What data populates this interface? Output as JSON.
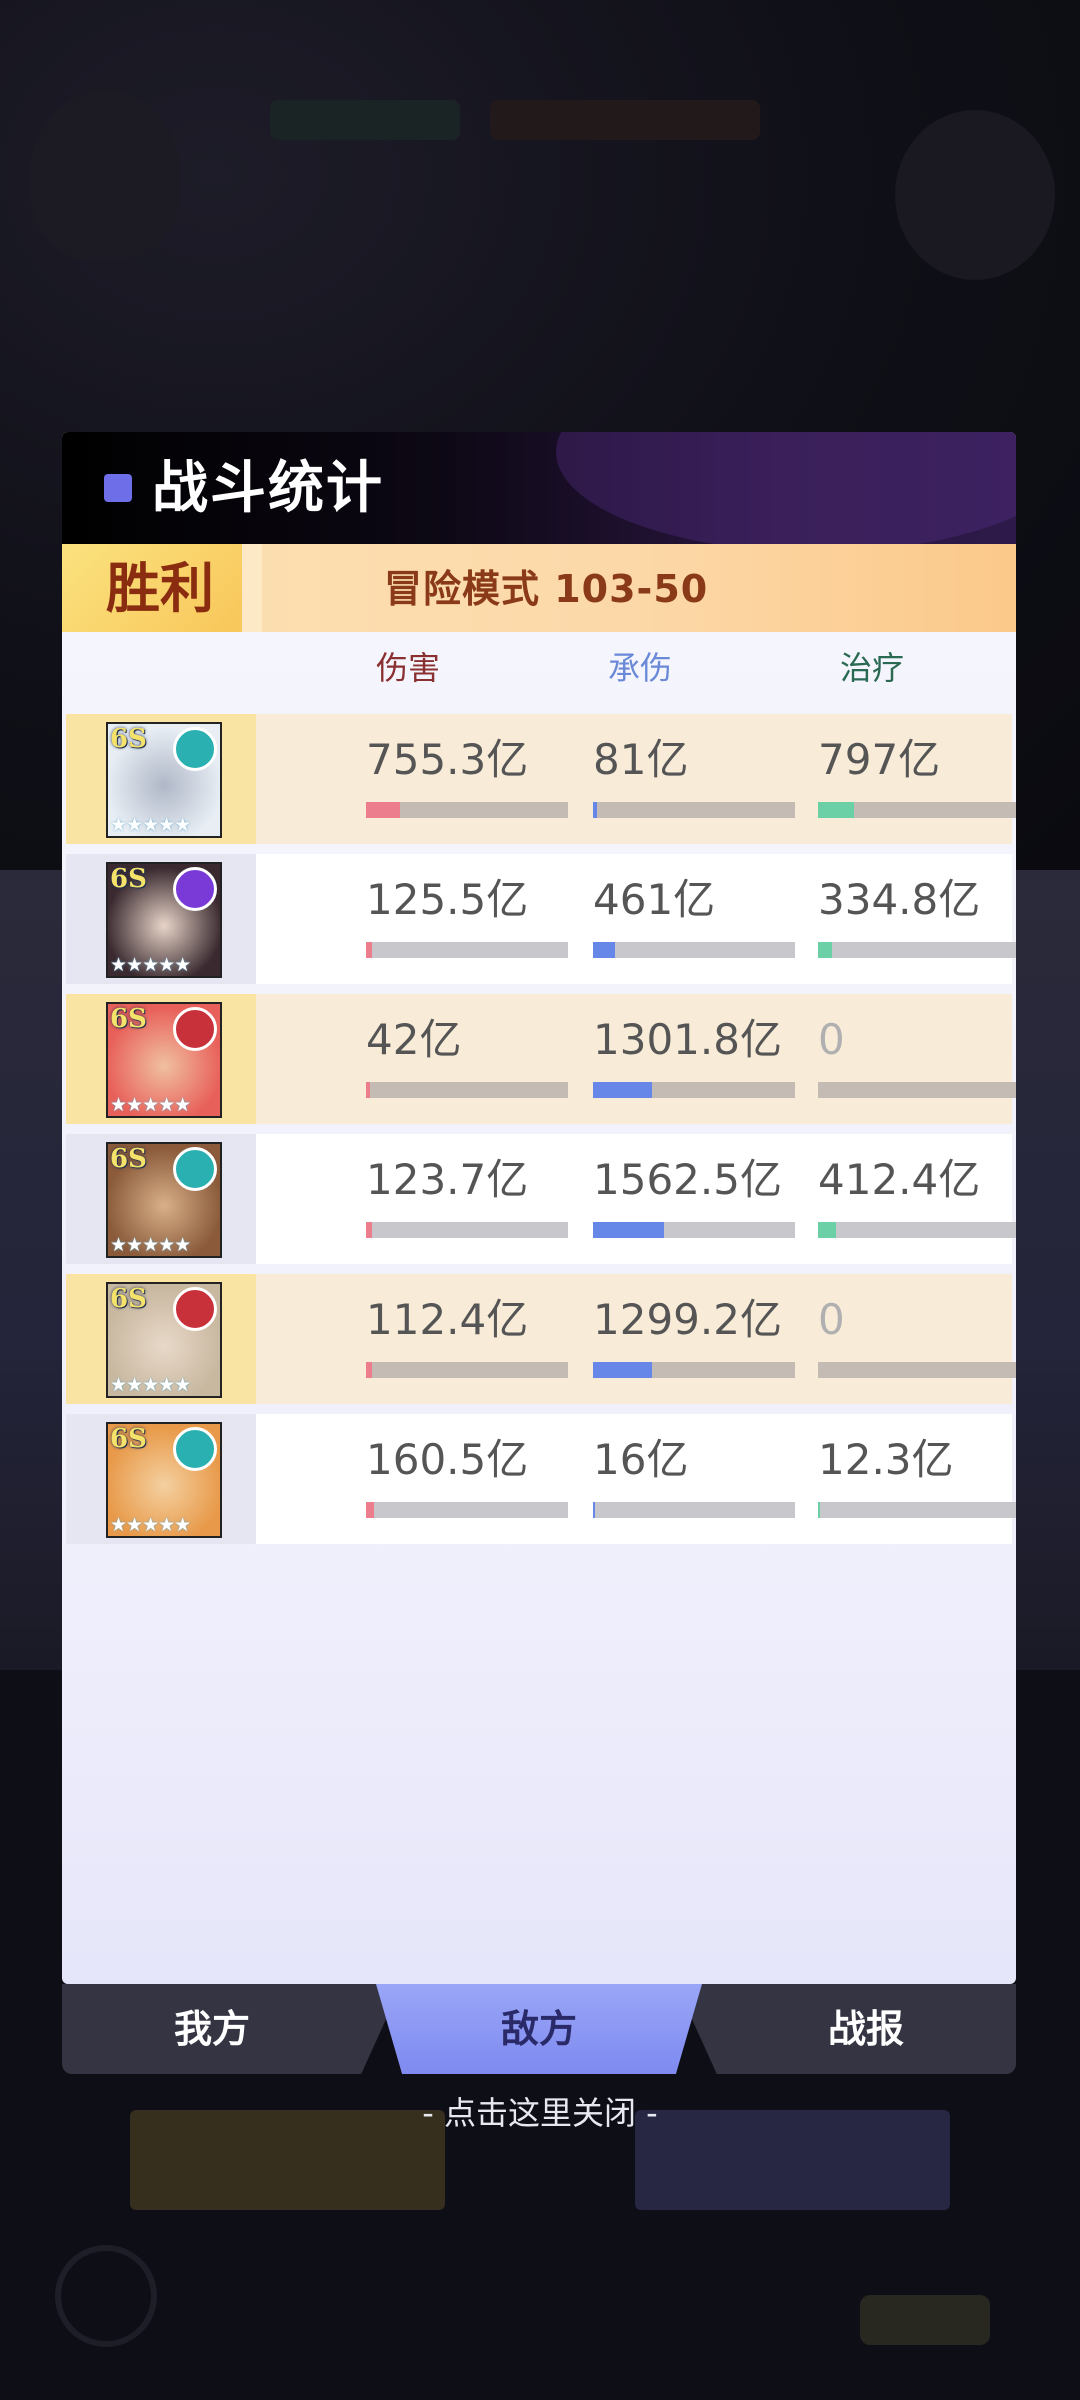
{
  "header": {
    "title": "战斗统计"
  },
  "result": {
    "outcome": "胜利",
    "stage": "冒险模式 103-50"
  },
  "columns": {
    "damage": "伤害",
    "taken": "承伤",
    "heal": "治疗"
  },
  "rows": [
    {
      "grade": "6S",
      "emblem": "nature-emblem-icon",
      "stars": "★★★★★",
      "damage": "755.3亿",
      "damage_ratio": 0.17,
      "taken": "81亿",
      "taken_ratio": 0.02,
      "heal": "797亿",
      "heal_ratio": 0.18
    },
    {
      "grade": "6S",
      "emblem": "moon-emblem-icon",
      "stars": "★★★★★",
      "damage": "125.5亿",
      "damage_ratio": 0.03,
      "taken": "461亿",
      "taken_ratio": 0.11,
      "heal": "334.8亿",
      "heal_ratio": 0.07
    },
    {
      "grade": "6S",
      "emblem": "fire-emblem-icon",
      "stars": "★★★★★",
      "damage": "42亿",
      "damage_ratio": 0.02,
      "taken": "1301.8亿",
      "taken_ratio": 0.29,
      "heal": "0",
      "heal_ratio": 0
    },
    {
      "grade": "6S",
      "emblem": "nature-emblem-icon",
      "stars": "★★★★★",
      "damage": "123.7亿",
      "damage_ratio": 0.03,
      "taken": "1562.5亿",
      "taken_ratio": 0.35,
      "heal": "412.4亿",
      "heal_ratio": 0.09
    },
    {
      "grade": "6S",
      "emblem": "fire-emblem-icon",
      "stars": "★★★★★",
      "damage": "112.4亿",
      "damage_ratio": 0.03,
      "taken": "1299.2亿",
      "taken_ratio": 0.29,
      "heal": "0",
      "heal_ratio": 0
    },
    {
      "grade": "6S",
      "emblem": "nature-emblem-icon",
      "stars": "★★★★★",
      "damage": "160.5亿",
      "damage_ratio": 0.04,
      "taken": "16亿",
      "taken_ratio": 0.01,
      "heal": "12.3亿",
      "heal_ratio": 0.01
    }
  ],
  "tabs": {
    "mine": "我方",
    "enemy": "敌方",
    "report": "战报",
    "active": "enemy"
  },
  "close_hint": "- 点击这里关闭 -",
  "colors": {
    "damage_fill": "#ec7d8c",
    "taken_fill": "#6686e8",
    "heal_fill": "#6cd0a6",
    "nature_emblem": "#2ab0b0",
    "moon_emblem": "#7a3ad8",
    "fire_emblem": "#c8303a",
    "accent": "#6e6ee8"
  }
}
